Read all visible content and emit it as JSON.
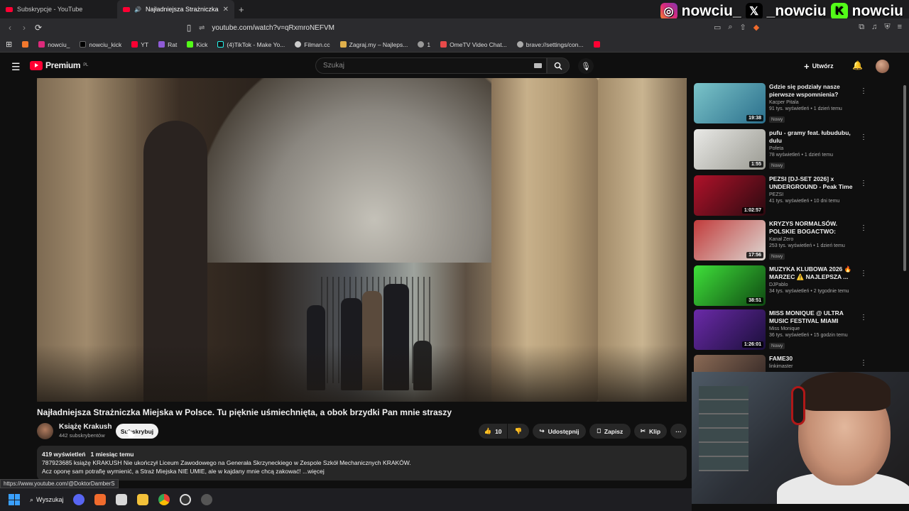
{
  "browser": {
    "tabs": [
      {
        "title": "Subskrypcje - YouTube",
        "active": false
      },
      {
        "title": "Najładniejsza Strażniczka Miej...",
        "active": true
      }
    ],
    "new_tab": "+",
    "url": "youtube.com/watch?v=qRxmroNEFVM",
    "bookmarks": [
      "nowciu_",
      "nowciu_kick",
      "YT",
      "Rat",
      "Kick",
      "(4)TikTok - Make Yo...",
      "Filman.cc",
      "Zagraj.my – Najleps...",
      "1",
      "OmeTV Video Chat...",
      "brave://settings/con..."
    ]
  },
  "overlay": {
    "handles": [
      "nowciu_",
      "_nowciu",
      "nowciu"
    ]
  },
  "youtube": {
    "logo_text": "Premium",
    "logo_region": "PL",
    "search_placeholder": "Szukaj",
    "create_label": "Utwórz"
  },
  "video": {
    "title": "Najładniejsza Strażniczka Miejska w Polsce. Tu pięknie uśmiechnięta, a obok brzydki Pan mnie straszy",
    "channel": "Książę Krakush",
    "subscribers": "442 subskrybentów",
    "subscribe_label": "Subskrybuj",
    "likes": "10",
    "share_label": "Udostępnij",
    "save_label": "Zapisz",
    "clip_label": "Klip",
    "more_label": "···",
    "views": "419 wyświetleń",
    "age": "1 miesiąc temu",
    "desc_line1": "787923685 książę KRAKUSH Nie ukończył Liceum Zawodowego na Generała Skrzyneckiego w Zespole Szkół Mechanicznych KRAKÓW.",
    "desc_line2": "Acz oponę sam potrafię wymienić, a Straż Miejska NIE UMIE, ale w kajdany mnie chcą zakować! ...więcej"
  },
  "status_url": "https://www.youtube.com/@DoktorDamberS",
  "recommended": [
    {
      "title": "Gdzie się podziały nasze pierwsze wspomnienia?",
      "channel": "Kacper Pitala",
      "views": "91 tys. wyświetleń • 1 dzień temu",
      "badge": "Nowy",
      "duration": "19:38",
      "colors": [
        "#7bc4c9",
        "#2b6f8c"
      ]
    },
    {
      "title": "pufu - gramy feat. łubudubu, dulu",
      "channel": "Pofeta",
      "views": "78 wyświetleń • 1 dzień temu",
      "badge": "Nowy",
      "duration": "1:55",
      "colors": [
        "#e9e9e6",
        "#9a9a92"
      ]
    },
    {
      "title": "PEZSI [DJ-SET 2026] x UNDERGROUND - Peak Time ...",
      "channel": "PEZSI",
      "views": "41 tys. wyświetleń • 10 dni temu",
      "badge": "",
      "duration": "1:02:57",
      "colors": [
        "#b0122a",
        "#2b0a10"
      ]
    },
    {
      "title": "KRYZYS NORMALSÓW. POLSKIE BOGACTWO: KREDY...",
      "channel": "Kanał Zero",
      "views": "253 tys. wyświetleń • 1 dzień temu",
      "badge": "Nowy",
      "duration": "17:56",
      "colors": [
        "#c23b3b",
        "#ddd8d2"
      ]
    },
    {
      "title": "MUZYKA KLUBOWA 2026 🔥 MARZEC ⚠️ NAJLEPSZA ...",
      "channel": "DJPablo",
      "views": "34 tys. wyświetleń • 2 tygodnie temu",
      "badge": "",
      "duration": "38:51",
      "colors": [
        "#3fe03a",
        "#0f4a12"
      ]
    },
    {
      "title": "MISS MONIQUE @ ULTRA MUSIC FESTIVAL MIAMI 2026...",
      "channel": "Miss Monique",
      "views": "36 tys. wyświetleń • 15 godzin temu",
      "badge": "Nowy",
      "duration": "1:26:01",
      "colors": [
        "#6b2aa8",
        "#1a0f3a"
      ]
    },
    {
      "title": "FAME30",
      "channel": "linkimaster",
      "views": "",
      "badge": "",
      "duration": "",
      "colors": [
        "#8a6a55",
        "#2a2020"
      ]
    }
  ],
  "taskbar": {
    "search_label": "Wyszukaj"
  }
}
